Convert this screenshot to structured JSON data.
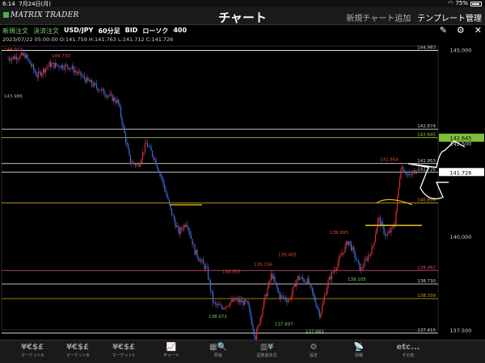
{
  "status": {
    "time": "6:14",
    "date": "7月24日(月)",
    "battery": "75%"
  },
  "header": {
    "logo": "MATRIX TRADER",
    "title": "チャート",
    "new_chart_label": "新規チャート追加",
    "template_label": "テンプレート管理"
  },
  "toolbar": {
    "new_order": "新規注文",
    "settle_order": "決済注文",
    "pair": "USD/JPY",
    "timeframe": "60分足",
    "price_type": "BID",
    "chart_type": "ローソク",
    "count": "400",
    "pencil_icon": "pencil-icon",
    "gear_icon": "gear-icon",
    "close_icon": "close-icon"
  },
  "info_line": "2023/07/22 05:00:00   O:141.759   H:141.763   L:141.712   C:141.726",
  "chart_data": {
    "type": "candlestick",
    "pair": "USD/JPY",
    "ylim": [
      137.5,
      145.1
    ],
    "y_ticks": [
      "145.000",
      "142.500",
      "140.000",
      "137.500"
    ],
    "horizontal_lines": [
      {
        "label": "144.983",
        "value": 144.983,
        "color": "#ffffff"
      },
      {
        "label": "142.874",
        "value": 142.874,
        "color": "#ffffff"
      },
      {
        "label": "142.645",
        "value": 142.645,
        "color": "#9acd32"
      },
      {
        "label": "141.953",
        "value": 141.953,
        "color": "#ffffff"
      },
      {
        "label": "141.726",
        "value": 141.726,
        "color": "#ffffff"
      },
      {
        "label": "140.896",
        "value": 140.896,
        "color": "#d4a020"
      },
      {
        "label": "139.092",
        "value": 139.092,
        "color": "#e05090"
      },
      {
        "label": "138.730",
        "value": 138.73,
        "color": "#ffffff"
      },
      {
        "label": "138.339",
        "value": 138.339,
        "color": "#d4a020"
      },
      {
        "label": "137.415",
        "value": 137.415,
        "color": "#ffffff"
      }
    ],
    "current_price": "141.726",
    "green_price_tag": "142.645",
    "high_labels": [
      "144.912",
      "144.733",
      "141.954",
      "139.993",
      "139.405",
      "139.156",
      "138.955"
    ],
    "low_labels": [
      "143.986",
      "138.071",
      "137.234",
      "137.897",
      "137.683",
      "139.105"
    ],
    "up_color": "#e03030",
    "down_color": "#3a6fd8"
  },
  "bottom_nav": [
    {
      "icon": "¥€$£",
      "label": "マーケットA"
    },
    {
      "icon": "¥€$£",
      "label": "マーケットB"
    },
    {
      "icon": "¥€$£",
      "label": "マーケットC"
    },
    {
      "icon": "chart-icon",
      "label": "チャート"
    },
    {
      "icon": "search-icon",
      "label": "照会"
    },
    {
      "icon": "chart-yen-icon",
      "label": "証拠金状況"
    },
    {
      "icon": "gear-wrench-icon",
      "label": "設定"
    },
    {
      "icon": "news-icon",
      "label": "情報"
    },
    {
      "icon": "etc...",
      "label": "その他"
    }
  ]
}
